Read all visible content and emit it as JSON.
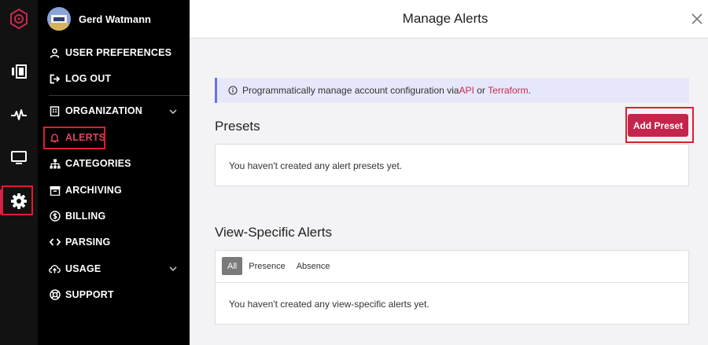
{
  "rail": {
    "items": [
      {
        "name": "logo-icon"
      },
      {
        "name": "dashboard-icon"
      },
      {
        "name": "activity-icon"
      },
      {
        "name": "monitor-icon"
      },
      {
        "name": "settings-gear-icon"
      }
    ],
    "accent_color": "#c8294f"
  },
  "user": {
    "name": "Gerd Watmann"
  },
  "menu": {
    "user_preferences": "USER PREFERENCES",
    "log_out": "LOG OUT",
    "organization": "ORGANIZATION",
    "alerts": "ALERTS",
    "categories": "CATEGORIES",
    "archiving": "ARCHIVING",
    "billing": "BILLING",
    "parsing": "PARSING",
    "usage": "USAGE",
    "support": "SUPPORT"
  },
  "main": {
    "title": "Manage Alerts",
    "banner": {
      "prefix": "Programmatically manage account configuration via ",
      "api_link": "API",
      "middle": " or ",
      "terraform_link": "Terraform",
      "suffix": "."
    },
    "presets": {
      "title": "Presets",
      "add_button": "Add Preset",
      "empty_text": "You haven't created any alert presets yet."
    },
    "view_specific": {
      "title": "View-Specific Alerts",
      "tabs": [
        "All",
        "Presence",
        "Absence"
      ],
      "active_tab": "All",
      "empty_text": "You haven't created any view-specific alerts yet."
    }
  },
  "colors": {
    "primary": "#c5254d",
    "highlight_outline": "#e01d2e",
    "banner_bg": "#e6e7fb"
  }
}
